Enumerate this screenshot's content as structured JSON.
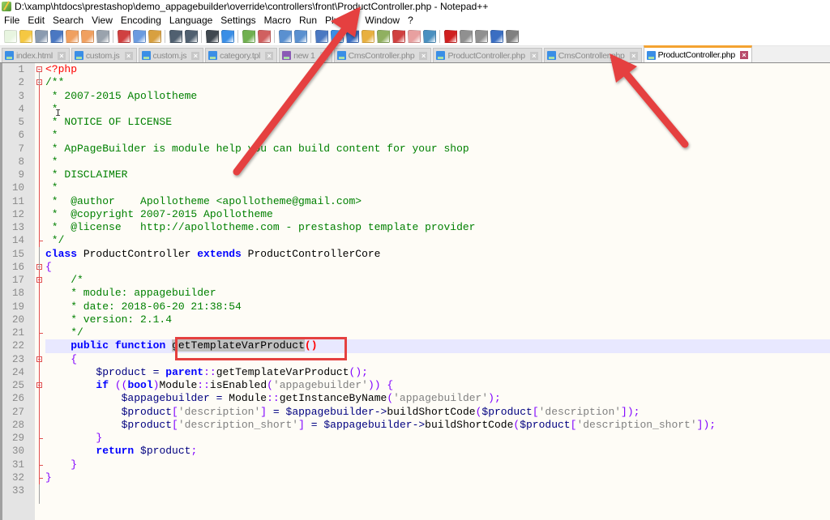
{
  "window": {
    "title": "D:\\xamp\\htdocs\\prestashop\\demo_appagebuilder\\override\\controllers\\front\\ProductController.php - Notepad++"
  },
  "menu": [
    "File",
    "Edit",
    "Search",
    "View",
    "Encoding",
    "Language",
    "Settings",
    "Macro",
    "Run",
    "Plugins",
    "Window",
    "?"
  ],
  "toolbar": {
    "icons": [
      "new-file-icon",
      "open-file-icon",
      "save-icon",
      "save-all-icon",
      "close-icon",
      "close-all-icon",
      "print-icon",
      "cut-icon",
      "copy-icon",
      "paste-icon",
      "undo-icon",
      "redo-icon",
      "find-icon",
      "replace-icon",
      "zoom-in-icon",
      "zoom-out-icon",
      "sync-vertical-icon",
      "sync-horizontal-icon",
      "word-wrap-icon",
      "show-all-chars-icon",
      "indent-guide-icon",
      "user-language-icon",
      "document-map-icon",
      "function-list-icon",
      "folder-workspace-icon",
      "monitoring-icon",
      "record-macro-icon",
      "stop-macro-icon",
      "play-macro-icon",
      "run-macro-multiple-icon",
      "save-macro-icon"
    ]
  },
  "tabs": [
    {
      "label": "index.html",
      "active": false,
      "color": "blue"
    },
    {
      "label": "custom.js",
      "active": false,
      "color": "blue"
    },
    {
      "label": "custom.js",
      "active": false,
      "color": "blue"
    },
    {
      "label": "category.tpl",
      "active": false,
      "color": "blue"
    },
    {
      "label": "new 1",
      "active": false,
      "color": "purple"
    },
    {
      "label": "CmsController.php",
      "active": false,
      "color": "blue"
    },
    {
      "label": "ProductController.php",
      "active": false,
      "color": "blue"
    },
    {
      "label": "CmsController.php",
      "active": false,
      "color": "blue"
    },
    {
      "label": "ProductController.php",
      "active": true,
      "color": "blue"
    }
  ],
  "editor": {
    "current_line": 22,
    "highlighted_function": "getTemplateVarProduct()",
    "lines": [
      [
        [
          "php",
          "<?php"
        ]
      ],
      [
        [
          "cmt",
          "/**"
        ]
      ],
      [
        [
          "cmt",
          " * 2007-2015 Apollotheme"
        ]
      ],
      [
        [
          "cmt",
          " *"
        ]
      ],
      [
        [
          "cmt",
          " * NOTICE OF LICENSE"
        ]
      ],
      [
        [
          "cmt",
          " *"
        ]
      ],
      [
        [
          "cmt",
          " * ApPageBuilder is module help you can build content for your shop"
        ]
      ],
      [
        [
          "cmt",
          " *"
        ]
      ],
      [
        [
          "cmt",
          " * DISCLAIMER"
        ]
      ],
      [
        [
          "cmt",
          " *"
        ]
      ],
      [
        [
          "cmt",
          " *  @author    Apollotheme <apollotheme@gmail.com>"
        ]
      ],
      [
        [
          "cmt",
          " *  @copyright 2007-2015 Apollotheme"
        ]
      ],
      [
        [
          "cmt",
          " *  @license   http://apollotheme.com - prestashop template provider"
        ]
      ],
      [
        [
          "cmt",
          " */"
        ]
      ],
      [
        [
          "kw",
          "class"
        ],
        [
          "pl",
          " ProductController "
        ],
        [
          "kw",
          "extends"
        ],
        [
          "pl",
          " ProductControllerCore"
        ]
      ],
      [
        [
          "op",
          "{"
        ]
      ],
      [
        [
          "cmt",
          "    /*"
        ]
      ],
      [
        [
          "cmt",
          "    * module: appagebuilder"
        ]
      ],
      [
        [
          "cmt",
          "    * date: 2018-06-20 21:38:54"
        ]
      ],
      [
        [
          "cmt",
          "    * version: 2.1.4"
        ]
      ],
      [
        [
          "cmt",
          "    */"
        ]
      ],
      [
        [
          "pl",
          "    "
        ],
        [
          "kw",
          "public"
        ],
        [
          "pl",
          " "
        ],
        [
          "kw",
          "function"
        ],
        [
          "pl",
          " "
        ],
        [
          "sel",
          "getTemplateVarProduct"
        ],
        [
          "brace",
          "()"
        ]
      ],
      [
        [
          "pl",
          "    "
        ],
        [
          "op",
          "{"
        ]
      ],
      [
        [
          "pl",
          "        "
        ],
        [
          "var",
          "$product"
        ],
        [
          "pl",
          " "
        ],
        [
          "id",
          "="
        ],
        [
          "pl",
          " "
        ],
        [
          "kw",
          "parent"
        ],
        [
          "op",
          "::"
        ],
        [
          "pl",
          "getTemplateVarProduct"
        ],
        [
          "op",
          "();"
        ]
      ],
      [
        [
          "pl",
          "        "
        ],
        [
          "kw",
          "if"
        ],
        [
          "pl",
          " "
        ],
        [
          "op",
          "(("
        ],
        [
          "kw",
          "bool"
        ],
        [
          "op",
          ")"
        ],
        [
          "pl",
          "Module"
        ],
        [
          "op",
          "::"
        ],
        [
          "pl",
          "isEnabled"
        ],
        [
          "op",
          "("
        ],
        [
          "str",
          "'appagebuilder'"
        ],
        [
          "op",
          "))"
        ],
        [
          "pl",
          " "
        ],
        [
          "op",
          "{"
        ]
      ],
      [
        [
          "pl",
          "            "
        ],
        [
          "var",
          "$appagebuilder"
        ],
        [
          "pl",
          " "
        ],
        [
          "id",
          "="
        ],
        [
          "pl",
          " Module"
        ],
        [
          "op",
          "::"
        ],
        [
          "pl",
          "getInstanceByName"
        ],
        [
          "op",
          "("
        ],
        [
          "str",
          "'appagebuilder'"
        ],
        [
          "op",
          ");"
        ]
      ],
      [
        [
          "pl",
          "            "
        ],
        [
          "var",
          "$product"
        ],
        [
          "op",
          "["
        ],
        [
          "str",
          "'description'"
        ],
        [
          "op",
          "]"
        ],
        [
          "pl",
          " "
        ],
        [
          "id",
          "="
        ],
        [
          "pl",
          " "
        ],
        [
          "var",
          "$appagebuilder"
        ],
        [
          "id",
          "->"
        ],
        [
          "pl",
          "buildShortCode"
        ],
        [
          "op",
          "("
        ],
        [
          "var",
          "$product"
        ],
        [
          "op",
          "["
        ],
        [
          "str",
          "'description'"
        ],
        [
          "op",
          "]);"
        ]
      ],
      [
        [
          "pl",
          "            "
        ],
        [
          "var",
          "$product"
        ],
        [
          "op",
          "["
        ],
        [
          "str",
          "'description_short'"
        ],
        [
          "op",
          "]"
        ],
        [
          "pl",
          " "
        ],
        [
          "id",
          "="
        ],
        [
          "pl",
          " "
        ],
        [
          "var",
          "$appagebuilder"
        ],
        [
          "id",
          "->"
        ],
        [
          "pl",
          "buildShortCode"
        ],
        [
          "op",
          "("
        ],
        [
          "var",
          "$product"
        ],
        [
          "op",
          "["
        ],
        [
          "str",
          "'description_short'"
        ],
        [
          "op",
          "]);"
        ]
      ],
      [
        [
          "pl",
          "        "
        ],
        [
          "op",
          "}"
        ]
      ],
      [
        [
          "pl",
          "        "
        ],
        [
          "kw",
          "return"
        ],
        [
          "pl",
          " "
        ],
        [
          "var",
          "$product"
        ],
        [
          "op",
          ";"
        ]
      ],
      [
        [
          "pl",
          "    "
        ],
        [
          "op",
          "}"
        ]
      ],
      [
        [
          "op",
          "}"
        ]
      ],
      []
    ]
  },
  "annotations": {
    "arrow_color": "#e5403f",
    "arrow_targets": [
      "window-title",
      "active-tab"
    ],
    "highlight_box_target": "function-name"
  }
}
